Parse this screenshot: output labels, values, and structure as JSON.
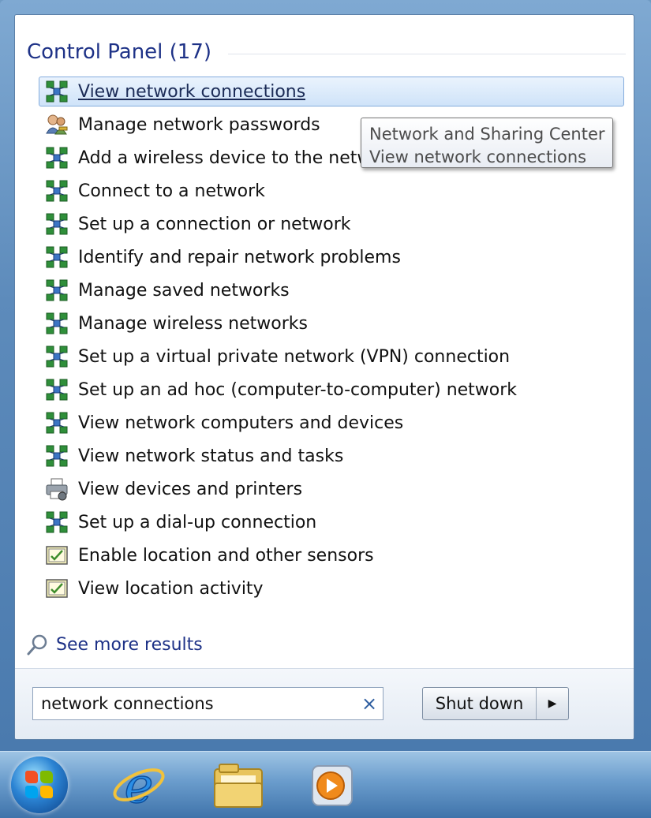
{
  "section": {
    "title": "Control Panel (17)"
  },
  "results": [
    {
      "label": "View network connections",
      "icon": "network-icon",
      "selected": true
    },
    {
      "label": "Manage network passwords",
      "icon": "users-key-icon"
    },
    {
      "label": "Add a wireless device to the netwo",
      "icon": "network-icon"
    },
    {
      "label": "Connect to a network",
      "icon": "network-icon"
    },
    {
      "label": "Set up a connection or network",
      "icon": "network-icon"
    },
    {
      "label": "Identify and repair network problems",
      "icon": "network-icon"
    },
    {
      "label": "Manage saved networks",
      "icon": "network-icon"
    },
    {
      "label": "Manage wireless networks",
      "icon": "network-icon"
    },
    {
      "label": "Set up a virtual private network (VPN) connection",
      "icon": "network-icon"
    },
    {
      "label": "Set up an ad hoc (computer-to-computer) network",
      "icon": "network-icon"
    },
    {
      "label": "View network computers and devices",
      "icon": "network-icon"
    },
    {
      "label": "View network status and tasks",
      "icon": "network-icon"
    },
    {
      "label": "View devices and printers",
      "icon": "printer-icon"
    },
    {
      "label": "Set up a dial-up connection",
      "icon": "network-icon"
    },
    {
      "label": "Enable location and other sensors",
      "icon": "location-sensor-icon"
    },
    {
      "label": "View location activity",
      "icon": "location-sensor-icon"
    }
  ],
  "tooltip": {
    "line1": "Network and Sharing Center",
    "line2": "View network connections"
  },
  "see_more": {
    "label": "See more results",
    "icon": "search-icon"
  },
  "search": {
    "value": "network connections",
    "clear_icon": "×"
  },
  "shutdown": {
    "label": "Shut down",
    "arrow": "▶"
  },
  "taskbar": {
    "items": [
      {
        "name": "start-orb-icon"
      },
      {
        "name": "internet-explorer-icon"
      },
      {
        "name": "file-explorer-icon"
      },
      {
        "name": "media-player-icon"
      }
    ]
  },
  "colors": {
    "accent_title": "#1e3287",
    "selection_border": "#84acdd",
    "taskbar_top": "#9ec4e4",
    "taskbar_bottom": "#3f73aa"
  }
}
